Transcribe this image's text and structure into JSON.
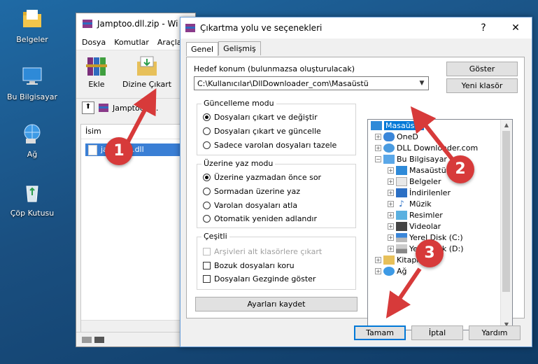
{
  "desktop": {
    "icons": [
      {
        "label": "Belgeler",
        "icon": "folder-icon"
      },
      {
        "label": "Bu Bilgisayar",
        "icon": "computer-icon"
      },
      {
        "label": "Ağ",
        "icon": "network-icon"
      },
      {
        "label": "Çöp Kutusu",
        "icon": "recycle-bin-icon"
      }
    ]
  },
  "rar": {
    "title": "Jamptoo.dll.zip - Wi",
    "menu": [
      "Dosya",
      "Komutlar",
      "Araçla"
    ],
    "tools": {
      "add": "Ekle",
      "extract": "Dizine Çıkart"
    },
    "path": "Jamptoo.dll.",
    "column": "İsim",
    "file": "jamptoo.dll"
  },
  "dialog": {
    "title": "Çıkartma yolu ve seçenekleri",
    "help": "?",
    "close": "✕",
    "tabs": [
      "Genel",
      "Gelişmiş"
    ],
    "dest_label": "Hedef konum (bulunmazsa oluşturulacak)",
    "dest_value": "C:\\Kullanıcılar\\DllDownloader_com\\Masaüstü",
    "show_btn": "Göster",
    "new_folder_btn": "Yeni klasör",
    "update_group": {
      "title": "Güncelleme modu",
      "options": [
        "Dosyaları çıkart ve değiştir",
        "Dosyaları çıkart ve güncelle",
        "Sadece varolan dosyaları tazele"
      ],
      "selected": 0
    },
    "overwrite_group": {
      "title": "Üzerine yaz modu",
      "options": [
        "Üzerine yazmadan önce sor",
        "Sormadan üzerine yaz",
        "Varolan dosyaları atla",
        "Otomatik yeniden adlandır"
      ],
      "selected": 0
    },
    "misc_group": {
      "title": "Çeşitli",
      "options": [
        "Arşivleri alt klasörlere çıkart",
        "Bozuk dosyaları koru",
        "Dosyaları Gezginde göster"
      ]
    },
    "save_btn": "Ayarları kaydet",
    "tree": {
      "root": "Masaüstü",
      "l1": [
        "OneD",
        "DLL Downloader.com",
        "Bu Bilgisayar"
      ],
      "pc": [
        "Masaüstü",
        "Belgeler",
        "İndirilenler",
        "Müzik",
        "Resimler",
        "Videolar",
        "Yerel Disk (C:)",
        "Yerel Disk (D:)"
      ],
      "tail": [
        "Kitaplıklar",
        "Ağ"
      ]
    },
    "ok": "Tamam",
    "cancel": "İptal",
    "helpbtn": "Yardım"
  },
  "markers": [
    "1",
    "2",
    "3"
  ],
  "colors": {
    "marker": "#d73a3a",
    "selection": "#0078d7"
  }
}
